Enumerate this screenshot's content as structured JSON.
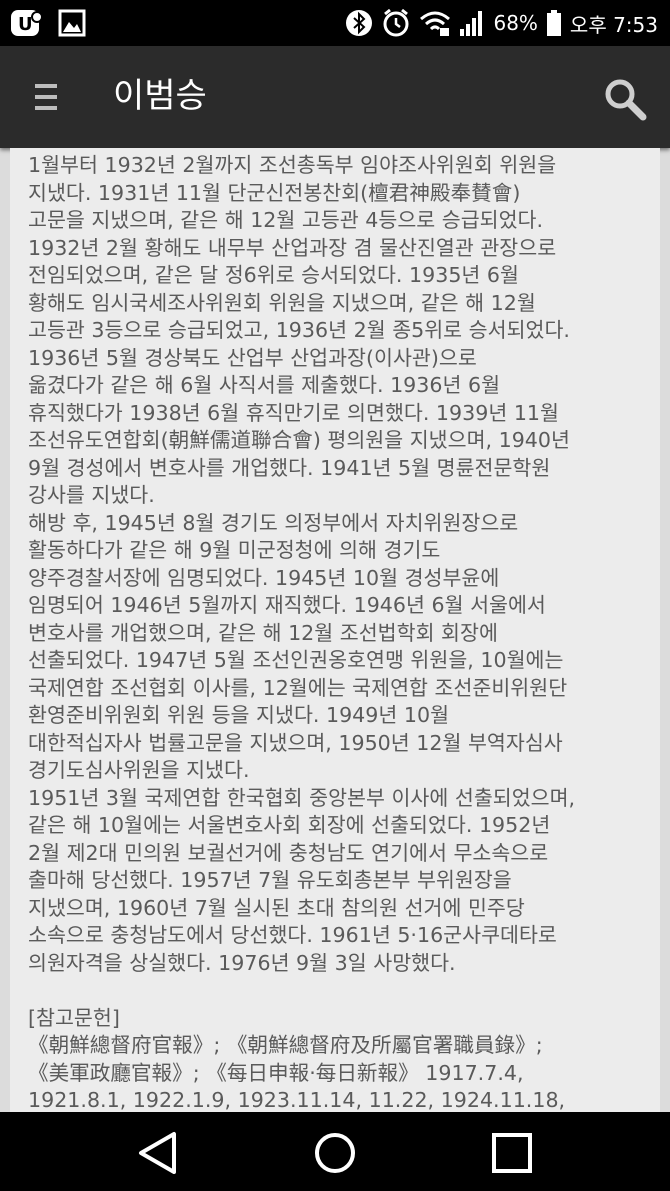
{
  "status_bar": {
    "battery": "68%",
    "time": "오후 7:53"
  },
  "app_bar": {
    "title": "이범승"
  },
  "article_lines": [
    "1월부터 1932년 2월까지 조선총독부 임야조사위원회 위원을",
    "지냈다. 1931년 11월 단군신전봉찬회(檀君神殿奉賛會)",
    "고문을 지냈으며, 같은 해 12월 고등관 4등으로 승급되었다.",
    "1932년 2월 황해도 내무부 산업과장 겸 물산진열관 관장으로",
    "전임되었으며, 같은 달 정6위로 승서되었다. 1935년 6월",
    "황해도 임시국세조사위원회 위원을 지냈으며, 같은 해 12월",
    "고등관 3등으로 승급되었고, 1936년 2월 종5위로 승서되었다.",
    "1936년 5월 경상북도 산업부 산업과장(이사관)으로",
    "옮겼다가 같은 해 6월 사직서를 제출했다. 1936년 6월",
    "휴직했다가 1938년 6월 휴직만기로 의면했다. 1939년 11월",
    "조선유도연합회(朝鮮儒道聯合會) 평의원을 지냈으며, 1940년",
    "9월 경성에서 변호사를 개업했다. 1941년 5월 명륜전문학원",
    "강사를 지냈다.",
    "해방 후, 1945년 8월 경기도 의정부에서 자치위원장으로",
    "활동하다가 같은 해 9월 미군정청에 의해 경기도",
    "양주경찰서장에 임명되었다. 1945년 10월 경성부윤에",
    "임명되어 1946년 5월까지 재직했다. 1946년 6월 서울에서",
    "변호사를 개업했으며, 같은 해 12월 조선법학회 회장에",
    "선출되었다. 1947년 5월 조선인권옹호연맹 위원을, 10월에는",
    "국제연합 조선협회 이사를, 12월에는 국제연합 조선준비위원단",
    "환영준비위원회 위원 등을 지냈다. 1949년 10월",
    "대한적십자사 법률고문을 지냈으며, 1950년 12월 부역자심사",
    "경기도심사위원을 지냈다.",
    "1951년 3월 국제연합 한국협회 중앙본부 이사에 선출되었으며,",
    "같은 해 10월에는 서울변호사회 회장에 선출되었다. 1952년",
    "2월 제2대 민의원 보궐선거에 충청남도 연기에서 무소속으로",
    "출마해 당선했다. 1957년 7월 유도회총본부 부위원장을",
    "지냈으며, 1960년 7월 실시된 초대 참의원 선거에 민주당",
    "소속으로 충청남도에서 당선했다. 1961년 5·16군사쿠데타로",
    "의원자격을 상실했다. 1976년 9월 3일 사망했다.",
    "",
    "[참고문헌]",
    "《朝鮮總督府官報》; 《朝鮮總督府及所屬官署職員錄》;",
    "《美軍政廳官報》; 《每日申報·每日新報》 1917.7.4,",
    "1921.8.1, 1922.1.9, 1923.11.14, 11.22, 1924.11.18,"
  ]
}
